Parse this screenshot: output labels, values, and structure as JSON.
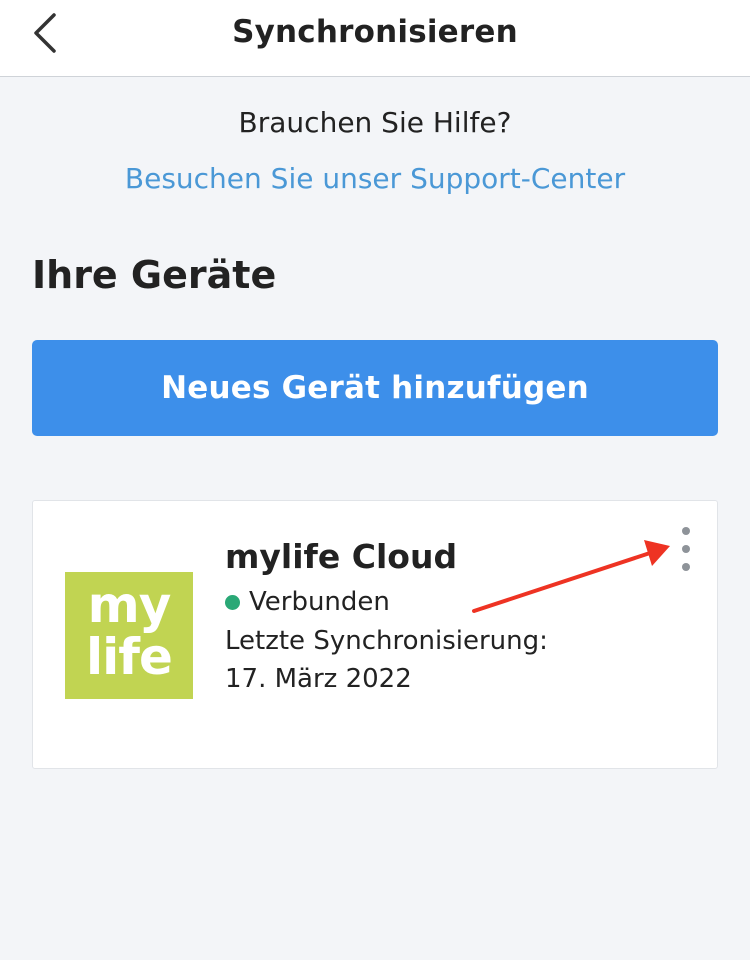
{
  "header": {
    "title": "Synchronisieren",
    "back_icon": "chevron-left-icon"
  },
  "help": {
    "question": "Brauchen Sie Hilfe?",
    "link_text": "Besuchen Sie unser Support-Center"
  },
  "devices_section": {
    "title": "Ihre Geräte",
    "add_button_label": "Neues Gerät hinzufügen"
  },
  "device": {
    "logo_line1": "my",
    "logo_line2": "life",
    "name": "mylife Cloud",
    "status": "Verbunden",
    "sync_label": "Letzte Synchronisierung:",
    "sync_date": "17. März 2022",
    "menu_icon": "more-vertical-icon"
  },
  "colors": {
    "accent_blue": "#3d8fea",
    "link_blue": "#4a98d6",
    "status_green": "#2aa876",
    "logo_green": "#c1d452",
    "annotation_red": "#ee3323"
  }
}
